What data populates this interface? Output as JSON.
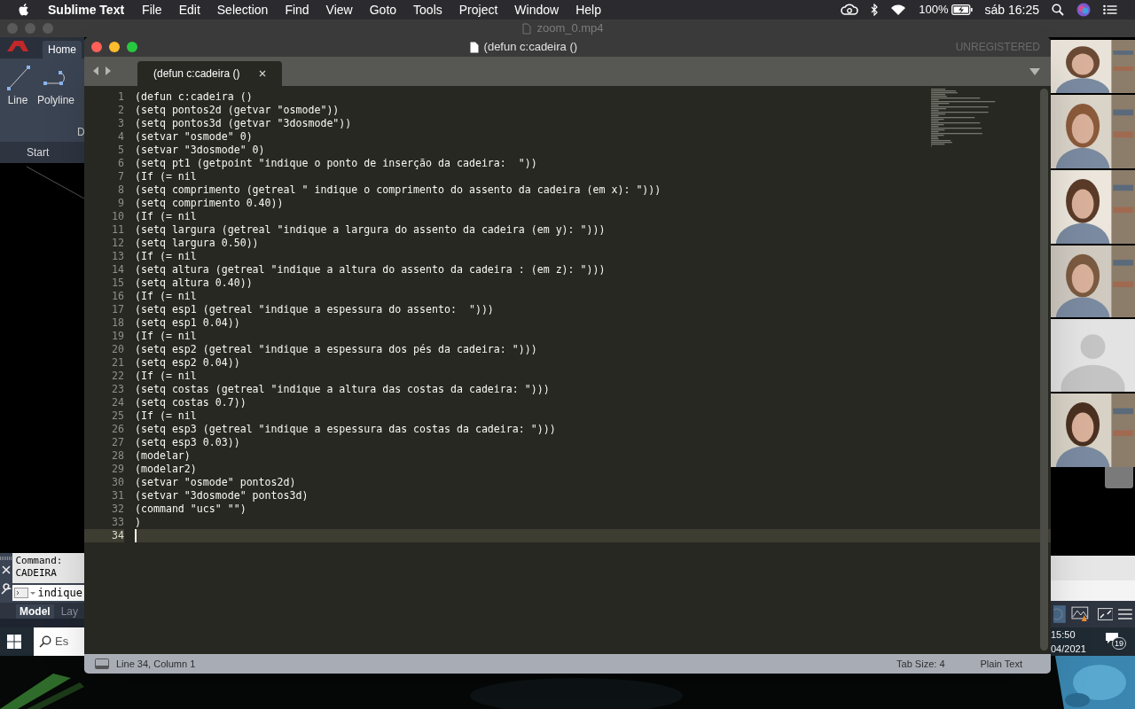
{
  "menu_bar": {
    "app": "Sublime Text",
    "items": [
      "File",
      "Edit",
      "Selection",
      "Find",
      "View",
      "Goto",
      "Tools",
      "Project",
      "Window",
      "Help"
    ],
    "battery": "100%",
    "clock": "sáb 16:25"
  },
  "player_window": {
    "title": "zoom_0.mp4"
  },
  "autocad": {
    "ribbon_tab": "Home",
    "tools": [
      {
        "label": "Line",
        "kind": "line"
      },
      {
        "label": "Polyline",
        "kind": "polyline"
      }
    ],
    "panel_label": "D",
    "file_tab": "Start",
    "command_history": [
      "Command:",
      "CADEIRA"
    ],
    "command_input": "indique",
    "layout_tabs": [
      {
        "label": "Model",
        "selected": true
      },
      {
        "label": "Lay",
        "selected": false
      }
    ]
  },
  "taskbar": {
    "search": "Es",
    "time": "15:50",
    "date": "04/2021",
    "notifications": "19"
  },
  "editor": {
    "title": "(defun c:cadeira ()",
    "license": "UNREGISTERED",
    "tabs": [
      {
        "label": "(defun c:cadeira ()",
        "selected": true
      }
    ],
    "lines": [
      {
        "number": "1",
        "text": "(defun c:cadeira ()",
        "cursor": false
      },
      {
        "number": "2",
        "text": "(setq pontos2d (getvar \"osmode\"))",
        "cursor": false
      },
      {
        "number": "3",
        "text": "(setq pontos3d (getvar \"3dosmode\"))",
        "cursor": false
      },
      {
        "number": "4",
        "text": "(setvar \"osmode\" 0)",
        "cursor": false
      },
      {
        "number": "5",
        "text": "(setvar \"3dosmode\" 0)",
        "cursor": false
      },
      {
        "number": "6",
        "text": "(setq pt1 (getpoint \"indique o ponto de inserção da cadeira:  \"))",
        "cursor": false
      },
      {
        "number": "7",
        "text": "(If (= nil",
        "cursor": false
      },
      {
        "number": "8",
        "text": "(setq comprimento (getreal \" indique o comprimento do assento da cadeira (em x): \")))",
        "cursor": false
      },
      {
        "number": "9",
        "text": "(setq comprimento 0.40))",
        "cursor": false
      },
      {
        "number": "10",
        "text": "(If (= nil",
        "cursor": false
      },
      {
        "number": "11",
        "text": "(setq largura (getreal \"indique a largura do assento da cadeira (em y): \")))",
        "cursor": false
      },
      {
        "number": "12",
        "text": "(setq largura 0.50))",
        "cursor": false
      },
      {
        "number": "13",
        "text": "(If (= nil",
        "cursor": false
      },
      {
        "number": "14",
        "text": "(setq altura (getreal \"indique a altura do assento da cadeira : (em z): \")))",
        "cursor": false
      },
      {
        "number": "15",
        "text": "(setq altura 0.40))",
        "cursor": false
      },
      {
        "number": "16",
        "text": "(If (= nil",
        "cursor": false
      },
      {
        "number": "17",
        "text": "(setq esp1 (getreal \"indique a espessura do assento:  \")))",
        "cursor": false
      },
      {
        "number": "18",
        "text": "(setq esp1 0.04))",
        "cursor": false
      },
      {
        "number": "19",
        "text": "(If (= nil",
        "cursor": false
      },
      {
        "number": "20",
        "text": "(setq esp2 (getreal \"indique a espessura dos pés da cadeira: \")))",
        "cursor": false
      },
      {
        "number": "21",
        "text": "(setq esp2 0.04))",
        "cursor": false
      },
      {
        "number": "22",
        "text": "(If (= nil",
        "cursor": false
      },
      {
        "number": "23",
        "text": "(setq costas (getreal \"indique a altura das costas da cadeira: \")))",
        "cursor": false
      },
      {
        "number": "24",
        "text": "(setq costas 0.7))",
        "cursor": false
      },
      {
        "number": "25",
        "text": "(If (= nil",
        "cursor": false
      },
      {
        "number": "26",
        "text": "(setq esp3 (getreal \"indique a espessura das costas da cadeira: \")))",
        "cursor": false
      },
      {
        "number": "27",
        "text": "(setq esp3 0.03))",
        "cursor": false
      },
      {
        "number": "28",
        "text": "(modelar)",
        "cursor": false
      },
      {
        "number": "29",
        "text": "(modelar2)",
        "cursor": false
      },
      {
        "number": "30",
        "text": "(setvar \"osmode\" pontos2d)",
        "cursor": false
      },
      {
        "number": "31",
        "text": "(setvar \"3dosmode\" pontos3d)",
        "cursor": false
      },
      {
        "number": "32",
        "text": "(command \"ucs\" \"\")",
        "cursor": false
      },
      {
        "number": "33",
        "text": ")",
        "cursor": false
      },
      {
        "number": "34",
        "cursor": true
      }
    ],
    "status": {
      "position": "Line 34, Column 1",
      "tab_size": "Tab Size: 4",
      "syntax": "Plain Text"
    }
  },
  "participants": [
    {
      "kind": "video"
    },
    {
      "kind": "video"
    },
    {
      "kind": "video"
    },
    {
      "kind": "video"
    },
    {
      "kind": "avatar"
    },
    {
      "kind": "video"
    }
  ]
}
